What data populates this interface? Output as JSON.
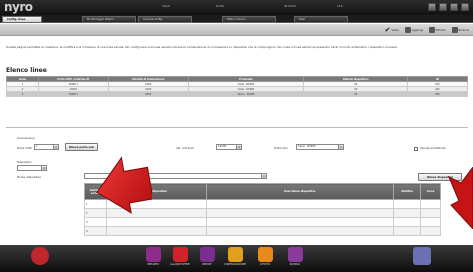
{
  "app": {
    "logo": "nyro",
    "info": [
      "Utenti",
      "Profilo",
      "00:00:00",
      "16.8"
    ]
  },
  "tabs": [
    {
      "label": "Config. linee",
      "active": true
    },
    {
      "label": "Monitoraggio allarmi",
      "active": false
    },
    {
      "label": "Console config.",
      "active": false
    },
    {
      "label": "Stato comunic.",
      "active": false
    },
    {
      "label": "Diari",
      "active": false
    }
  ],
  "toolbar": {
    "tools": [
      {
        "label": "Salva",
        "icon": "checkmark-icon"
      },
      {
        "label": "Aggiungi",
        "icon": "add-icon"
      },
      {
        "label": "Elimina",
        "icon": "delete-icon"
      },
      {
        "label": "Ricarica",
        "icon": "refresh-icon"
      }
    ]
  },
  "description": "Questa pagina permette la creazione, la modifica e la rimozione di una linea seriale. Per configurare una linea seriale indicare la combinazione di connessione e i dispositivi che la compongono. Sel. linea di linee seriali (se presente) Cerel di modo automatico i dispositivi connessi.",
  "lines_section": {
    "title": "Elenco linee",
    "columns": [
      "Linea",
      "Porta COM / Indirizzo IP",
      "Velocità di trasmissione",
      "Protocollo",
      "Ritardo dispositivo",
      "ID"
    ],
    "rows": [
      [
        "1",
        "FORM 1",
        "2400",
        "Cerel - RS485",
        "00",
        "001"
      ],
      [
        "2",
        "COM1",
        "2400",
        "Cerel - RS485",
        "00",
        "201"
      ],
      [
        "3",
        "FORM 1",
        "2400",
        "Vallox - RS485",
        "00",
        "001"
      ]
    ]
  },
  "comm": {
    "title": "Connessione",
    "porta_label": "Porta COM",
    "porta_value": "1",
    "porta_button": "Rileva porta usb",
    "vel_label": "Vel. di trasm.",
    "vel_value": "19200",
    "protocol_label": "Protocollo",
    "protocol_value": "Cerel - RS485",
    "checkbox_label": "Utente predefinito",
    "dispositivi_label": "Dispositivi",
    "nome_label": "Nome dispositivo",
    "rileva_button": "Rileva dispositivi"
  },
  "devices": {
    "columns": [
      "Indirizzo seriale",
      "Tipo dispositivo",
      "Descrizione dispositivo",
      "Modifica",
      "Cerca"
    ],
    "rows": [
      "1",
      "2",
      "3",
      "4"
    ]
  },
  "bottom": [
    {
      "label": "",
      "icon": "alarm-icon",
      "color": "#c0272d"
    },
    {
      "label": "IMPIANTO",
      "icon": "plant-icon",
      "color": "#8e2c8c"
    },
    {
      "label": "ALLARMI EVENTI",
      "icon": "events-icon",
      "color": "#d2222a"
    },
    {
      "label": "REPORT",
      "icon": "report-icon",
      "color": "#7a2e8f"
    },
    {
      "label": "CONFIGURAZIONE",
      "icon": "configuration-icon",
      "color": "#e0a01c"
    },
    {
      "label": "ATTIVITÀ",
      "icon": "activity-icon",
      "color": "#e88a1b"
    },
    {
      "label": "RICERCA",
      "icon": "search-icon",
      "color": "#8a3a9a"
    },
    {
      "label": "",
      "icon": "home-icon",
      "color": "#6b6fb3"
    }
  ],
  "colors": {
    "arrow": "#d41515"
  }
}
